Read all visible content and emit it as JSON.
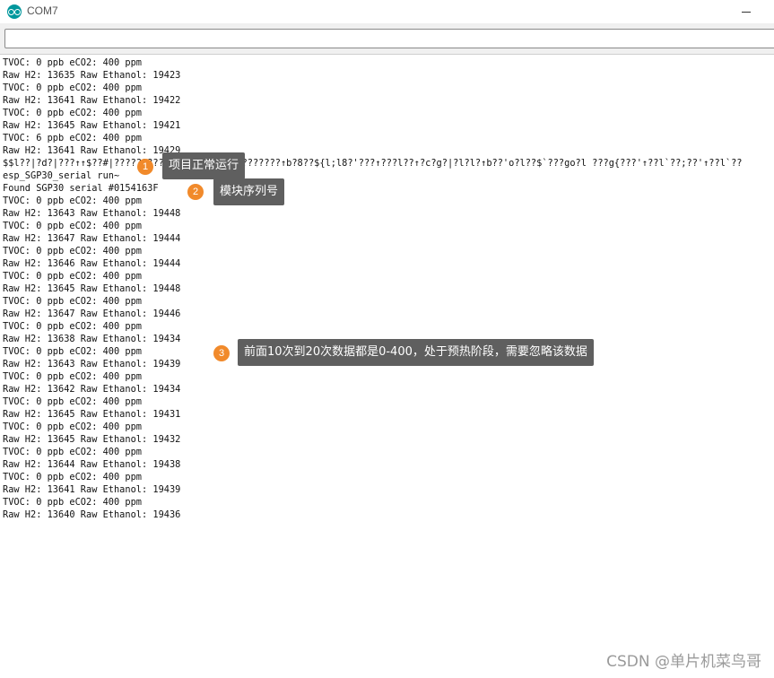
{
  "window": {
    "title": "COM7"
  },
  "send_input": {
    "value": ""
  },
  "console_lines": [
    "TVOC: 0 ppb eCO2: 400 ppm",
    "Raw H2: 13635 Raw Ethanol: 19423",
    "TVOC: 0 ppb eCO2: 400 ppm",
    "Raw H2: 13641 Raw Ethanol: 19422",
    "TVOC: 0 ppb eCO2: 400 ppm",
    "Raw H2: 13645 Raw Ethanol: 19421",
    "TVOC: 6 ppb eCO2: 400 ppm",
    "Raw H2: 13641 Raw Ethanol: 19429",
    "$$l??|?d?|???↑↑$??#|??????????????????????????????↑b?8??${l;l8?'???↑???l??↑?c?g?|?l?l?↑b??'o?l??$`???go?l ???g{???'↑??l`??;??'↑??l`??",
    "esp_SGP30_serial run~",
    "Found SGP30 serial #0154163F",
    "TVOC: 0 ppb eCO2: 400 ppm",
    "Raw H2: 13643 Raw Ethanol: 19448",
    "TVOC: 0 ppb eCO2: 400 ppm",
    "Raw H2: 13647 Raw Ethanol: 19444",
    "TVOC: 0 ppb eCO2: 400 ppm",
    "Raw H2: 13646 Raw Ethanol: 19444",
    "TVOC: 0 ppb eCO2: 400 ppm",
    "Raw H2: 13645 Raw Ethanol: 19448",
    "TVOC: 0 ppb eCO2: 400 ppm",
    "Raw H2: 13647 Raw Ethanol: 19446",
    "TVOC: 0 ppb eCO2: 400 ppm",
    "Raw H2: 13638 Raw Ethanol: 19434",
    "TVOC: 0 ppb eCO2: 400 ppm",
    "Raw H2: 13643 Raw Ethanol: 19439",
    "TVOC: 0 ppb eCO2: 400 ppm",
    "Raw H2: 13642 Raw Ethanol: 19434",
    "TVOC: 0 ppb eCO2: 400 ppm",
    "Raw H2: 13645 Raw Ethanol: 19431",
    "TVOC: 0 ppb eCO2: 400 ppm",
    "Raw H2: 13645 Raw Ethanol: 19432",
    "TVOC: 0 ppb eCO2: 400 ppm",
    "Raw H2: 13644 Raw Ethanol: 19438",
    "TVOC: 0 ppb eCO2: 400 ppm",
    "Raw H2: 13641 Raw Ethanol: 19439",
    "TVOC: 0 ppb eCO2: 400 ppm",
    "Raw H2: 13640 Raw Ethanol: 19436"
  ],
  "annotations": [
    {
      "number": "1",
      "text": "项目正常运行"
    },
    {
      "number": "2",
      "text": "模块序列号"
    },
    {
      "number": "3",
      "text": "前面10次到20次数据都是0-400，处于预热阶段，需要忽略该数据"
    }
  ],
  "watermark": "CSDN @单片机菜鸟哥",
  "colors": {
    "callout_badge": "#f18a2b",
    "callout_label_bg": "#5f5f5f",
    "arduino_teal": "#00979c"
  }
}
